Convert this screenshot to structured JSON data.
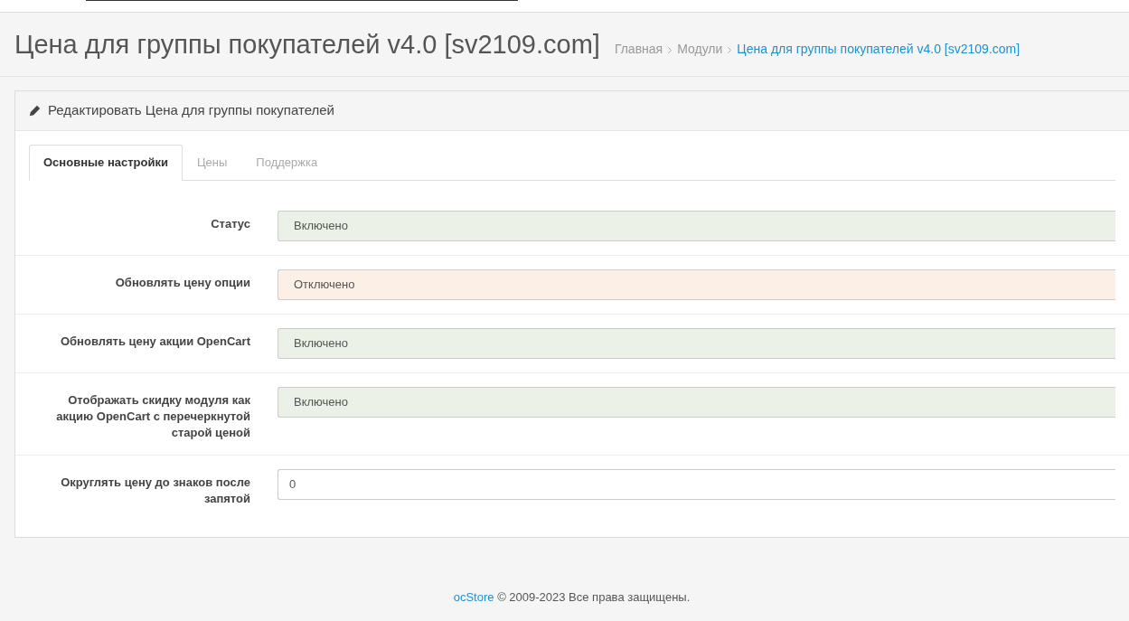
{
  "page_title": "Цена для группы покупателей v4.0 [sv2109.com]",
  "breadcrumbs": [
    {
      "label": "Главная",
      "selected": false
    },
    {
      "label": "Модули",
      "selected": false
    },
    {
      "label": "Цена для группы покупателей v4.0 [sv2109.com]",
      "selected": true
    }
  ],
  "panel": {
    "heading": "Редактировать Цена для группы покупателей",
    "tabs": [
      {
        "label": "Основные настройки",
        "selected": true
      },
      {
        "label": "Цены",
        "selected": false
      },
      {
        "label": "Поддержка",
        "selected": false
      }
    ],
    "fields": [
      {
        "kind": "select",
        "label": "Статус",
        "value": "Включено",
        "on": true
      },
      {
        "kind": "select",
        "label": "Обновлять цену опции",
        "value": "Отключено",
        "on": false
      },
      {
        "kind": "select",
        "label": "Обновлять цену акции OpenCart",
        "value": "Включено",
        "on": true
      },
      {
        "kind": "select",
        "label": "Отображать скидку модуля как акцию OpenCart с перечеркнутой старой ценой",
        "value": "Включено",
        "on": true
      },
      {
        "kind": "input",
        "label": "Округлять цену до знаков после запятой",
        "value": "0"
      }
    ]
  },
  "footer": {
    "link": "ocStore",
    "text": "© 2009-2023 Все права защищены."
  }
}
